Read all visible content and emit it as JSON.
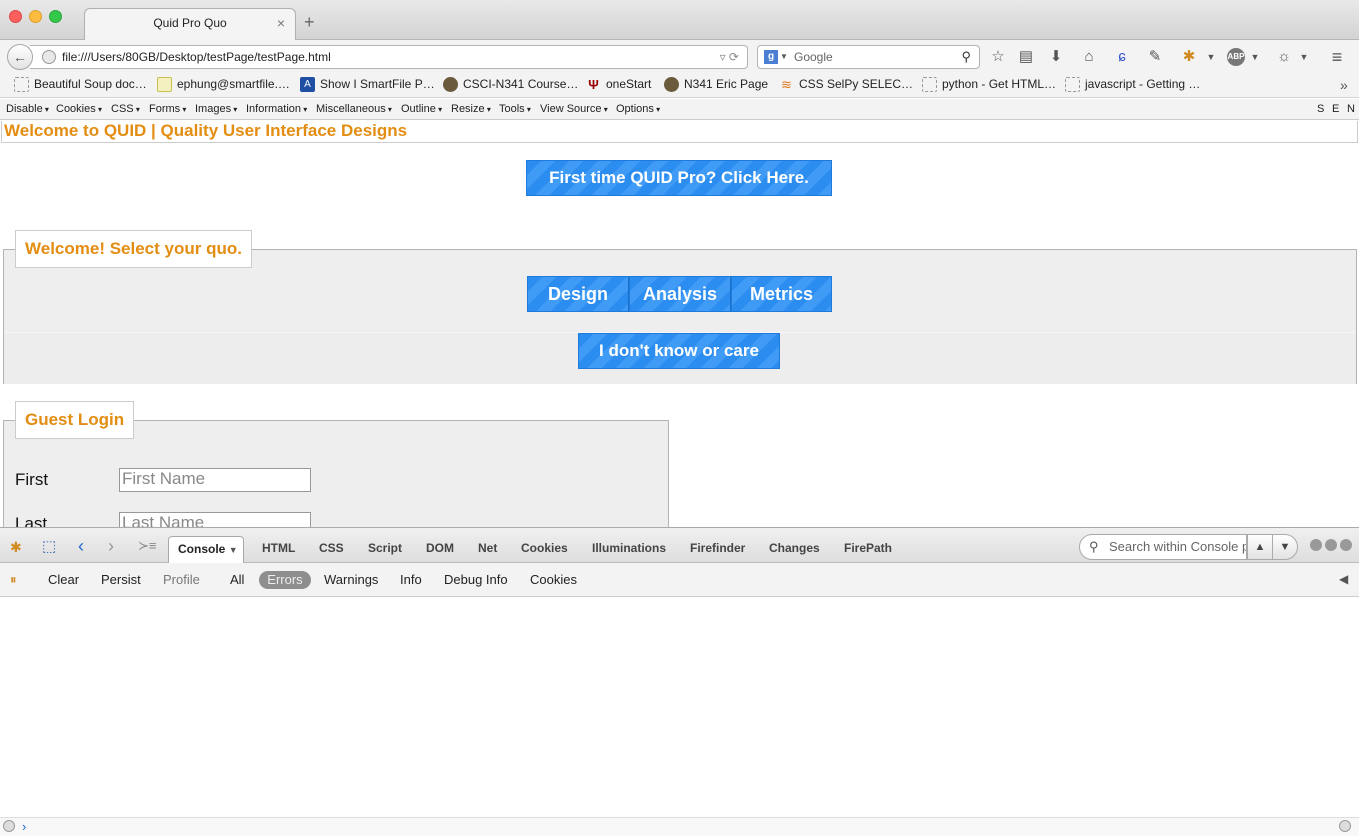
{
  "browser": {
    "tab_title": "Quid Pro Quo",
    "tab_close": "×",
    "new_tab": "+",
    "url": "file:///Users/80GB/Desktop/testPage/testPage.html",
    "search_placeholder": "Google",
    "bookmarks": [
      "Beautiful Soup doc…",
      "ephung@smartfile.…",
      "Show I SmartFile P…",
      "CSCI-N341 Course…",
      "oneStart",
      "N341 Eric Page",
      "CSS SelPy SELEC…",
      "python - Get HTML…",
      "javascript - Getting …"
    ],
    "overflow": "»"
  },
  "devtoolbar": {
    "menus": [
      "Disable",
      "Cookies",
      "CSS",
      "Forms",
      "Images",
      "Information",
      "Miscellaneous",
      "Outline",
      "Resize",
      "Tools",
      "View Source",
      "Options"
    ],
    "right": [
      "S",
      "E",
      "N"
    ]
  },
  "page": {
    "header": "Welcome to QUID | Quality User Interface Designs",
    "first_time_button": "First time QUID Pro? Click Here.",
    "quo_legend": "Welcome! Select your quo.",
    "quo_buttons": [
      "Design",
      "Analysis",
      "Metrics"
    ],
    "dont_care_button": "I don't know or care",
    "login_legend": "Guest Login",
    "first_label": "First",
    "first_placeholder": "First Name",
    "last_label": "Last",
    "last_placeholder": "Last Name"
  },
  "firebug": {
    "tabs": [
      "Console",
      "HTML",
      "CSS",
      "Script",
      "DOM",
      "Net",
      "Cookies",
      "Illuminations",
      "Firefinder",
      "Changes",
      "FirePath"
    ],
    "search_placeholder": "Search within Console panel",
    "toolbar": [
      "Clear",
      "Persist",
      "Profile",
      "All",
      "Errors",
      "Warnings",
      "Info",
      "Debug Info",
      "Cookies"
    ],
    "prompt": "›"
  }
}
